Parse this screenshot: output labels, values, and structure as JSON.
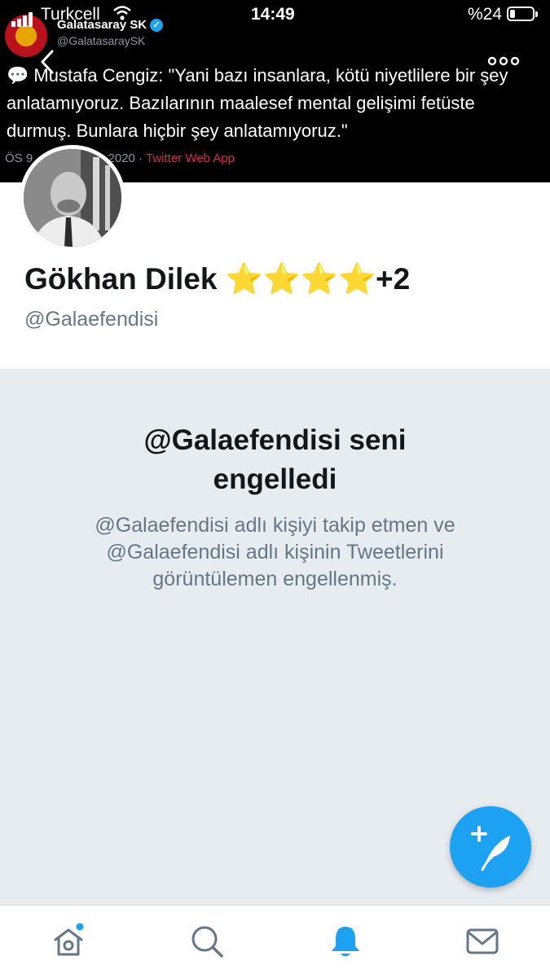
{
  "status_bar": {
    "carrier": "Turkcell",
    "time": "14:49",
    "battery": "%24",
    "battery_level": 0.24
  },
  "embedded_tweet": {
    "name": "Galatasaray SK",
    "handle": "@GalatasaraySK",
    "text": "Mustafa Cengiz: \"Yani bazı insanlara, kötü niyetlilere bir şey anlatamıyoruz. Bazılarının maalesef mental gelişimi fetüste durmuş. Bunlara hiçbir şey anlatamıyoruz.\"",
    "meta_date": "ÖS 9",
    "meta_year": "2020",
    "meta_separator": "·",
    "meta_app": "Twitter Web App"
  },
  "profile": {
    "name": "Gökhan Dilek",
    "stars": "⭐⭐⭐⭐",
    "plus": "+2",
    "handle": "@Galaefendisi"
  },
  "blocked": {
    "title_line1": "@Galaefendisi seni",
    "title_line2": "engelledi",
    "desc_line1": "@Galaefendisi adlı kişiyi takip etmen ve",
    "desc_line2": "@Galaefendisi adlı kişinin Tweetlerini",
    "desc_line3": "görüntülemen engellenmiş."
  },
  "tabs": [
    {
      "icon": "home-icon",
      "has_badge": true
    },
    {
      "icon": "search-icon"
    },
    {
      "icon": "notifications-icon",
      "active": true
    },
    {
      "icon": "messages-icon"
    }
  ],
  "colors": {
    "accent": "#1da1f2",
    "muted": "#657786",
    "panel": "#e6ecf0"
  }
}
